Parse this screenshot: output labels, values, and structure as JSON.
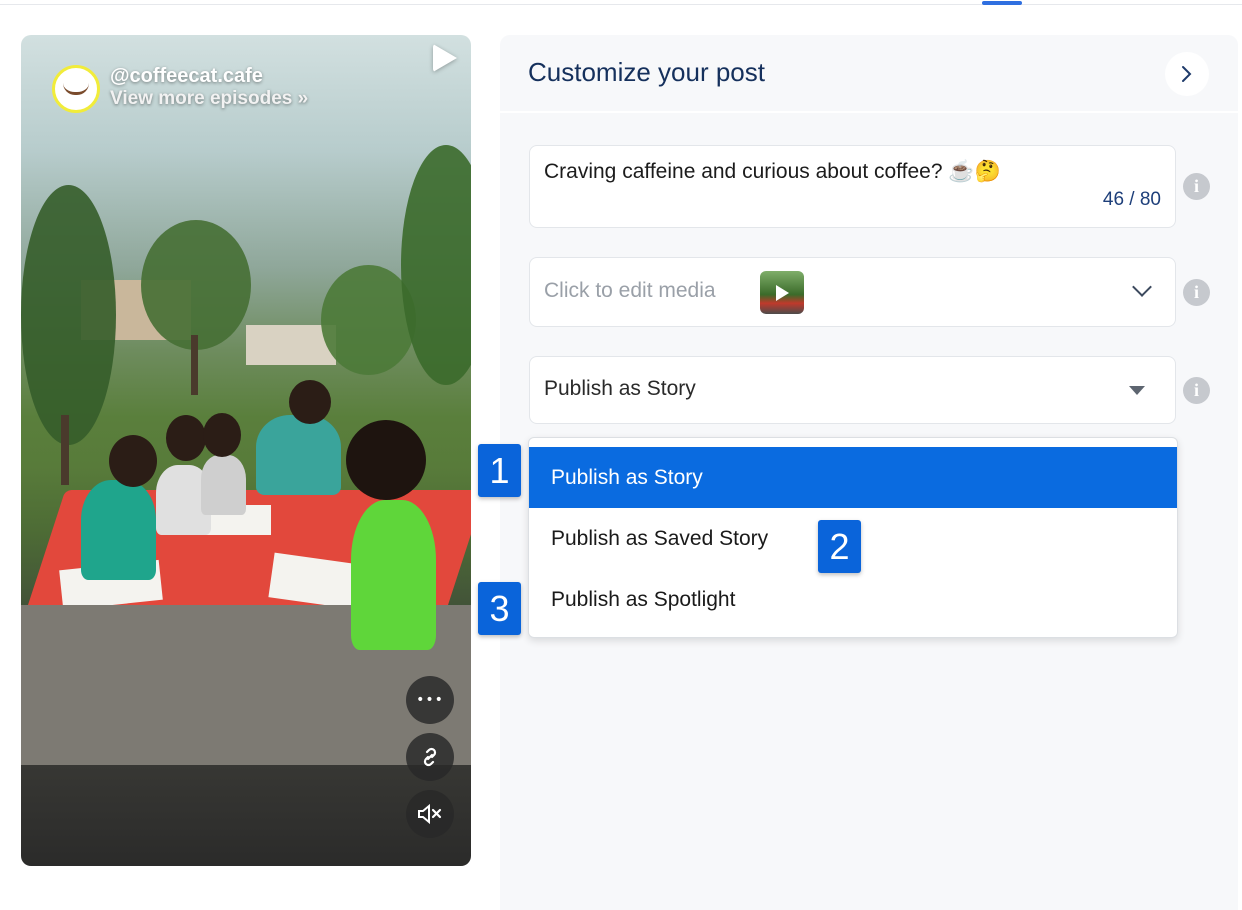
{
  "preview": {
    "username": "@coffeecat.cafe",
    "subtitle": "View more episodes »",
    "actions": [
      {
        "name": "more-options-button",
        "icon": "ellipsis-icon",
        "glyph": "•••"
      },
      {
        "name": "copy-link-button",
        "icon": "link-icon",
        "glyph": "🔗"
      },
      {
        "name": "mute-button",
        "icon": "speaker-muted-icon",
        "glyph": "🔇"
      }
    ]
  },
  "panel": {
    "title": "Customize your post",
    "caption": {
      "value": "Craving caffeine and curious about coffee? ☕🤔",
      "counter": "46 / 80"
    },
    "media": {
      "placeholder": "Click to edit media"
    },
    "publish_select": {
      "selected": "Publish as Story",
      "options": [
        "Publish as Story",
        "Publish as Saved Story",
        "Publish as Spotlight"
      ]
    },
    "info_glyph": "i"
  },
  "badges": [
    "1",
    "2",
    "3"
  ],
  "colors": {
    "accent": "#0a6be0",
    "title": "#15305c",
    "panel_bg": "#f7f8fa"
  }
}
